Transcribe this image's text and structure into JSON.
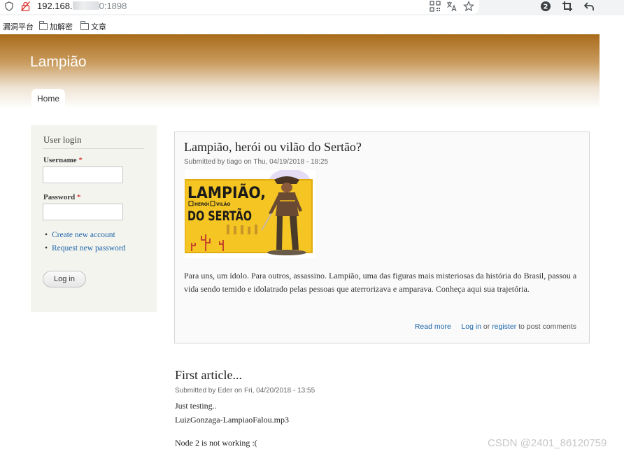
{
  "browser": {
    "url_host": "192.168.",
    "url_port": "0:1898",
    "bookmarks": [
      "漏洞平台",
      "加解密",
      "文章"
    ],
    "badge_count": "2"
  },
  "site": {
    "name": "Lampião",
    "tab_home": "Home"
  },
  "login": {
    "title": "User login",
    "username_label": "Username",
    "password_label": "Password",
    "required_mark": "*",
    "create_account": "Create new account",
    "request_password": "Request new password",
    "login_button": "Log in"
  },
  "article1": {
    "title": "Lampião, herói ou vilão do Sertão?",
    "submitted_prefix": "Submitted by",
    "author": "tiago",
    "date": "on Thu, 04/19/2018 - 18:25",
    "image_text": {
      "line1": "LAMPIÃO,",
      "opt1": "HERÓI",
      "opt2": "VILÃO",
      "line2": "DO SERTÃO"
    },
    "body": "Para uns, um ídolo. Para outros, assassino. Lampião, uma das figuras mais misteriosas da história do Brasil, passou a vida sendo temido e idolatrado pelas pessoas que aterrorizava e amparava. Conheça aqui sua trajetória.",
    "read_more": "Read more",
    "log_in": "Log in",
    "or": "or",
    "register": "register",
    "post_comments": "to post comments"
  },
  "article2": {
    "title": "First article...",
    "submitted_prefix": "Submitted by",
    "author": "Eder",
    "date": "on Fri, 04/20/2018 - 13:55",
    "line1": "Just testing..",
    "line2": "LuizGonzaga-LampiaoFalou.mp3",
    "line3": "Node 2 is not working :("
  },
  "watermark": "CSDN @2401_86120759",
  "colors": {
    "header_brown": "#a86a1a",
    "link_blue": "#1b64a8",
    "sidebar_bg": "#f4f4ef"
  },
  "icons": [
    "shield-icon",
    "insecure-lock-icon",
    "qr-code-icon",
    "translate-icon",
    "star-icon",
    "extension-badge-icon",
    "crop-icon",
    "back-icon"
  ]
}
